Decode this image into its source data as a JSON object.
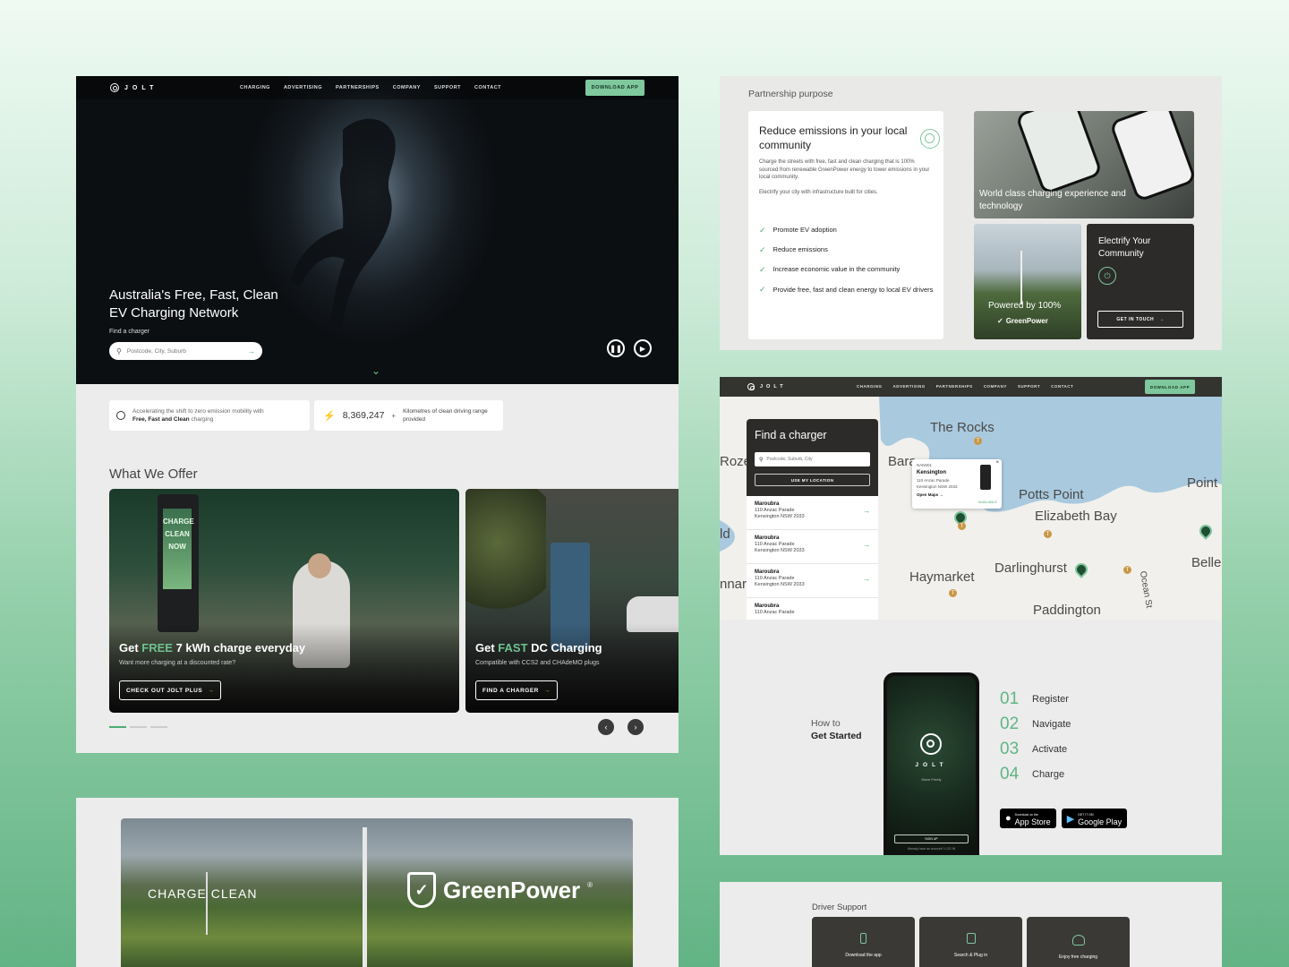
{
  "site": {
    "brand": "JOLT",
    "nav": [
      "CHARGING",
      "ADVERTISING",
      "PARTNERSHIPS",
      "COMPANY",
      "SUPPORT",
      "CONTACT"
    ],
    "download_button": "DOWNLOAD APP"
  },
  "home": {
    "hero_title_line1": "Australia's Free, Fast, Clean",
    "hero_title_line2": "EV Charging Network",
    "find_label": "Find a charger",
    "search_placeholder": "Postcode, City, Suburb",
    "stat1_text": "Accelerating the shift to zero emission mobility with",
    "stat1_bold": "Free, Fast and Clean",
    "stat1_tail": "charging",
    "stat2_value": "8,369,247",
    "stat2_plus": "+",
    "stat2_text": "Kilometres of clean driving range provided",
    "offer_heading": "What We Offer",
    "card1_pre": "Get ",
    "card1_hl": "FREE",
    "card1_post": " 7 kWh charge everyday",
    "card1_sub": "Want more charging at a discounted rate?",
    "card1_btn": "CHECK OUT JOLT PLUS",
    "card2_pre": "Get ",
    "card2_hl": "FAST",
    "card2_post": " DC Charging",
    "card2_sub": "Compatible with CCS2 and CHAdeMO plugs",
    "card2_btn": "FIND A CHARGER",
    "charger_screen_text": "CHARGE CLEAN NOW"
  },
  "partnership": {
    "heading": "Partnership purpose",
    "title": "Reduce emissions in your local community",
    "body": "Charge the streets with free, fast and clean charging that is 100% sourced from renewable GreenPower energy to lower emissions in your local community.",
    "body2": "Electrify your city with infrastructure built for cities.",
    "checks": [
      "Promote EV adoption",
      "Reduce emissions",
      "Increase economic value in the community",
      "Provide free, fast and clean energy to local EV drivers"
    ],
    "tile1": "World class charging experience and technology",
    "tile2_line1": "Powered by 100%",
    "tile2_brand": "GreenPower",
    "tile3": "Electrify Your Community",
    "tile3_btn": "GET IN TOUCH"
  },
  "map": {
    "panel_title": "Find a charger",
    "search_placeholder": "Postcode, Suburb, City",
    "location_btn": "USE MY LOCATION",
    "results": [
      {
        "name": "Maroubra",
        "line1": "110 Anzac Parade",
        "line2": "Kensington NSW 2033"
      },
      {
        "name": "Maroubra",
        "line1": "110 Anzac Parade",
        "line2": "Kensington NSW 2033"
      },
      {
        "name": "Maroubra",
        "line1": "110 Anzac Parade",
        "line2": "Kensington NSW 2033"
      },
      {
        "name": "Maroubra",
        "line1": "110 Anzac Parade",
        "line2": ""
      }
    ],
    "popup": {
      "code": "NAN001",
      "name": "Kensington",
      "line1": "110 Anzac Parade",
      "line2": "Kensington NSW 2033",
      "open": "Open Maps",
      "status": "AVAILABLE"
    },
    "labels": [
      "The Rocks",
      "Potts Point",
      "Elizabeth Bay",
      "Darlinghurst",
      "Haymarket",
      "Paddington",
      "Point",
      "Belle",
      "Ocean St",
      "Roze",
      "Bara",
      "ld",
      "nnar"
    ]
  },
  "started": {
    "heading_line1": "How to",
    "heading_line2": "Get Started",
    "steps": [
      {
        "n": "01",
        "label": "Register"
      },
      {
        "n": "02",
        "label": "Navigate"
      },
      {
        "n": "03",
        "label": "Activate"
      },
      {
        "n": "04",
        "label": "Charge"
      }
    ],
    "phone_brand": "JOLT",
    "phone_tag": "Move Freely",
    "phone_btn": "SIGN UP",
    "phone_footer": "Already have an account? LOG IN",
    "app_store_small": "Download on the",
    "app_store": "App Store",
    "google_small": "GET IT ON",
    "google": "Google Play"
  },
  "charge_clean": {
    "left": "CHARGE CLEAN",
    "brand": "GreenPower",
    "reg": "®"
  },
  "driver_support": {
    "heading": "Driver Support",
    "cards": [
      "Download the app",
      "Search & Plug in",
      "Enjoy free charging"
    ]
  }
}
